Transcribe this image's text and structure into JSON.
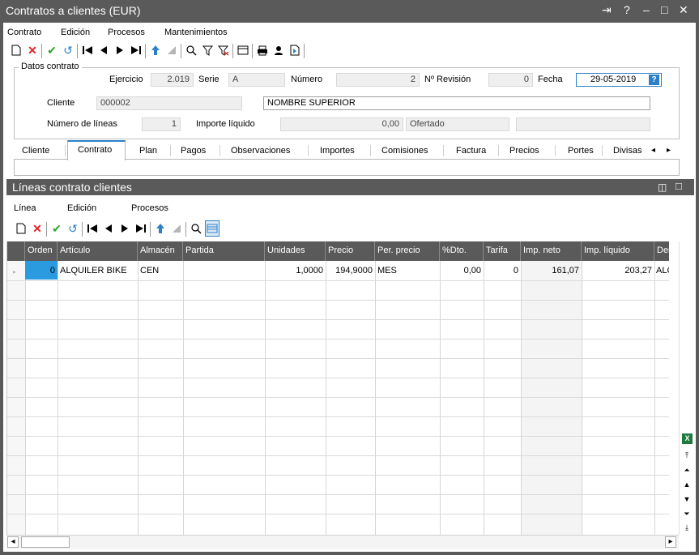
{
  "window": {
    "title": "Contratos a clientes (EUR)",
    "controls": {
      "pin": "⇥",
      "help": "?",
      "minimize": "–",
      "maximize": "□",
      "close": "✕"
    }
  },
  "menu": [
    "Contrato",
    "Edición",
    "Procesos",
    "Mantenimientos"
  ],
  "header": {
    "group_label": "Datos contrato",
    "ejercicio": {
      "label": "Ejercicio",
      "value": "2.019"
    },
    "serie": {
      "label": "Serie",
      "value": "A"
    },
    "numero": {
      "label": "Número",
      "value": "2"
    },
    "revision": {
      "label": "Nº Revisión",
      "value": "0"
    },
    "fecha": {
      "label": "Fecha",
      "value": "29-05-2019",
      "help": "?"
    },
    "cliente": {
      "label": "Cliente",
      "code": "000002",
      "name": "NOMBRE SUPERIOR"
    },
    "lineas": {
      "label": "Número de líneas",
      "value": "1"
    },
    "importe": {
      "label": "Importe líquido",
      "value": "0,00",
      "status": "Ofertado"
    }
  },
  "tabs": [
    "Cliente",
    "Contrato",
    "Plan",
    "Pagos",
    "Observaciones",
    "Importes",
    "Comisiones",
    "Factura",
    "Precios",
    "Portes",
    "Divisas"
  ],
  "tab_arrows": {
    "left": "◂",
    "right": "▸"
  },
  "lines_panel": {
    "title": "Líneas contrato clientes",
    "controls": {
      "restore": "◫",
      "maximize": "□"
    },
    "menu": [
      "Línea",
      "Edición",
      "Procesos"
    ]
  },
  "grid": {
    "columns": [
      "Orden",
      "Artículo",
      "Almacén",
      "Partida",
      "Unidades",
      "Precio",
      "Per. precio",
      "%Dto.",
      "Tarifa",
      "Imp. neto",
      "Imp. líquido",
      "Descr"
    ],
    "rows": [
      [
        "0",
        "ALQUILER BIKE",
        "CEN",
        "",
        "1,0000",
        "194,9000",
        "MES",
        "0,00",
        "0",
        "161,07",
        "203,27",
        "ALQU"
      ]
    ]
  },
  "scrollbar": {
    "excel": "X",
    "buttons": [
      "⤒",
      "⏶",
      "▲",
      "▼",
      "⏷",
      "⤓"
    ],
    "h_left": "◂",
    "h_right": "▸"
  },
  "colors": {
    "titlebar": "#5a5a5a",
    "accent": "#2b80c8",
    "delete": "#e0262b",
    "ok": "#2ba52b"
  }
}
